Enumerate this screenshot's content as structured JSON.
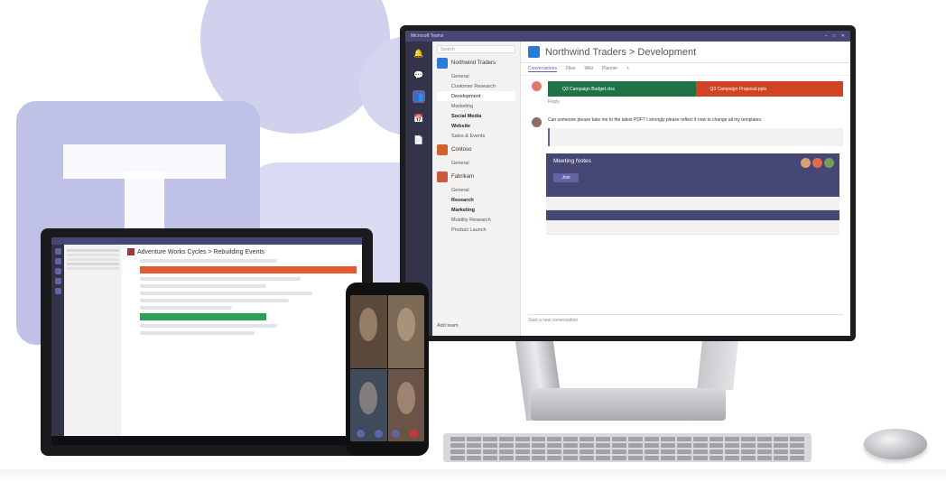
{
  "monitor": {
    "app_title": "Microsoft Teams",
    "search_placeholder": "Search",
    "rail": [
      "Activity",
      "Chat",
      "Teams",
      "Meetings",
      "Files"
    ],
    "teams": [
      {
        "name": "Northwind Traders",
        "channels": [
          "General",
          "Customer Research",
          "Development",
          "Marketing",
          "Social Media",
          "Website",
          "Sales & Events"
        ]
      },
      {
        "name": "Contoso",
        "channels": [
          "General"
        ]
      },
      {
        "name": "Fabrikam",
        "channels": [
          "General",
          "Research",
          "Marketing",
          "Mobility Research",
          "Product Launch"
        ]
      }
    ],
    "channel_header": "Northwind Traders > Development",
    "tabs": [
      "Conversations",
      "Files",
      "Wiki",
      "Planner",
      "+"
    ],
    "cards": {
      "green": "Q3 Campaign Budget.xlsx",
      "red": "Q3 Campaign Proposal.pptx"
    },
    "reply_label": "Reply",
    "message_text": "Can someone please take me to the latest PDF? I strongly please reflect it now to change all my templates.",
    "meeting_title": "Meeting Notes",
    "join_label": "Join",
    "compose_placeholder": "Start a new conversation",
    "add_team_label": "Add team"
  },
  "tablet": {
    "header": "Adventure Works Cycles > Rebuilding Events"
  },
  "colors": {
    "brand": "#6264a7",
    "brand_dark": "#464775",
    "excel_green": "#217346",
    "ppt_red": "#d04423"
  }
}
